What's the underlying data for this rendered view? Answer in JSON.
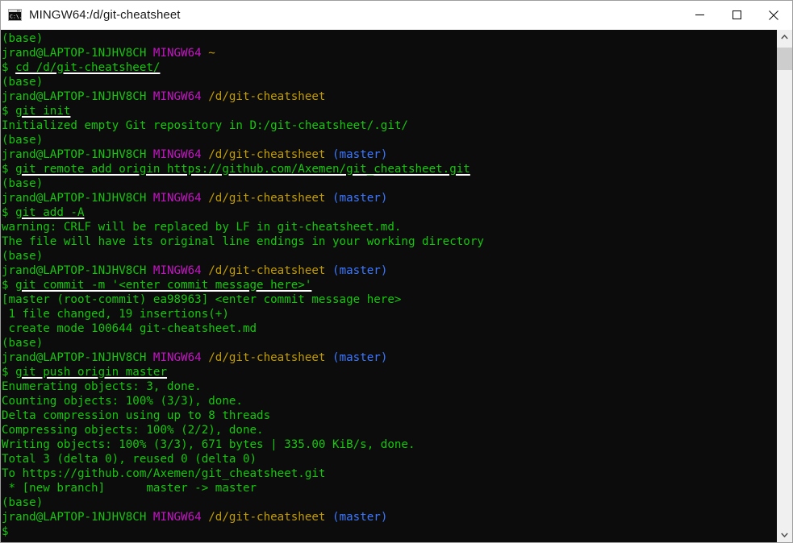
{
  "window": {
    "title": "MINGW64:/d/git-cheatsheet",
    "icon_name": "console-icon",
    "minimize_label": "Minimize",
    "maximize_label": "Maximize",
    "close_label": "Close"
  },
  "colors": {
    "background": "#0c0c0c",
    "green": "#16c60c",
    "magenta": "#c216c2",
    "yellow": "#c19c00",
    "cyan": "#3b78ff",
    "underline": "#ffffff",
    "titlebar_bg": "#ffffff",
    "scrollbar_bg": "#f0f0f0",
    "scrollbar_thumb": "#cdcdcd"
  },
  "terminal": {
    "user_host": "jrand@LAPTOP-1NJHV8CH",
    "shell_tag": "MINGW64",
    "env_prefix": "(base)",
    "prompt_symbol": "$",
    "branch": "(master)",
    "home_path": "~",
    "work_path": "/d/git-cheatsheet",
    "lines": [
      {
        "type": "env",
        "text": "(base)"
      },
      {
        "type": "prompt",
        "user": "jrand@LAPTOP-1NJHV8CH",
        "tag": "MINGW64",
        "path": "~",
        "branch": ""
      },
      {
        "type": "command",
        "text": "cd /d/git-cheatsheet/"
      },
      {
        "type": "env",
        "text": "(base)"
      },
      {
        "type": "prompt",
        "user": "jrand@LAPTOP-1NJHV8CH",
        "tag": "MINGW64",
        "path": "/d/git-cheatsheet",
        "branch": ""
      },
      {
        "type": "command",
        "text": "git init"
      },
      {
        "type": "output",
        "text": "Initialized empty Git repository in D:/git-cheatsheet/.git/"
      },
      {
        "type": "env",
        "text": "(base)"
      },
      {
        "type": "prompt",
        "user": "jrand@LAPTOP-1NJHV8CH",
        "tag": "MINGW64",
        "path": "/d/git-cheatsheet",
        "branch": "(master)"
      },
      {
        "type": "command",
        "text": "git remote add origin https://github.com/Axemen/git_cheatsheet.git"
      },
      {
        "type": "env",
        "text": "(base)"
      },
      {
        "type": "prompt",
        "user": "jrand@LAPTOP-1NJHV8CH",
        "tag": "MINGW64",
        "path": "/d/git-cheatsheet",
        "branch": "(master)"
      },
      {
        "type": "command",
        "text": "git add -A"
      },
      {
        "type": "output",
        "text": "warning: CRLF will be replaced by LF in git-cheatsheet.md."
      },
      {
        "type": "output",
        "text": "The file will have its original line endings in your working directory"
      },
      {
        "type": "env",
        "text": "(base)"
      },
      {
        "type": "prompt",
        "user": "jrand@LAPTOP-1NJHV8CH",
        "tag": "MINGW64",
        "path": "/d/git-cheatsheet",
        "branch": "(master)"
      },
      {
        "type": "command",
        "text": "git commit -m '<enter commit message here>'"
      },
      {
        "type": "output",
        "text": "[master (root-commit) ea98963] <enter commit message here>"
      },
      {
        "type": "output",
        "text": " 1 file changed, 19 insertions(+)"
      },
      {
        "type": "output",
        "text": " create mode 100644 git-cheatsheet.md"
      },
      {
        "type": "env",
        "text": "(base)"
      },
      {
        "type": "prompt",
        "user": "jrand@LAPTOP-1NJHV8CH",
        "tag": "MINGW64",
        "path": "/d/git-cheatsheet",
        "branch": "(master)"
      },
      {
        "type": "command",
        "text": "git push origin master"
      },
      {
        "type": "output",
        "text": "Enumerating objects: 3, done."
      },
      {
        "type": "output",
        "text": "Counting objects: 100% (3/3), done."
      },
      {
        "type": "output",
        "text": "Delta compression using up to 8 threads"
      },
      {
        "type": "output",
        "text": "Compressing objects: 100% (2/2), done."
      },
      {
        "type": "output",
        "text": "Writing objects: 100% (3/3), 671 bytes | 335.00 KiB/s, done."
      },
      {
        "type": "output",
        "text": "Total 3 (delta 0), reused 0 (delta 0)"
      },
      {
        "type": "output",
        "text": "To https://github.com/Axemen/git_cheatsheet.git"
      },
      {
        "type": "output",
        "text": " * [new branch]      master -> master"
      },
      {
        "type": "env",
        "text": "(base)"
      },
      {
        "type": "prompt",
        "user": "jrand@LAPTOP-1NJHV8CH",
        "tag": "MINGW64",
        "path": "/d/git-cheatsheet",
        "branch": "(master)"
      },
      {
        "type": "command",
        "text": ""
      }
    ]
  },
  "scrollbar": {
    "up_arrow_name": "scroll-up-arrow",
    "down_arrow_name": "scroll-down-arrow",
    "thumb_name": "scrollbar-thumb"
  }
}
